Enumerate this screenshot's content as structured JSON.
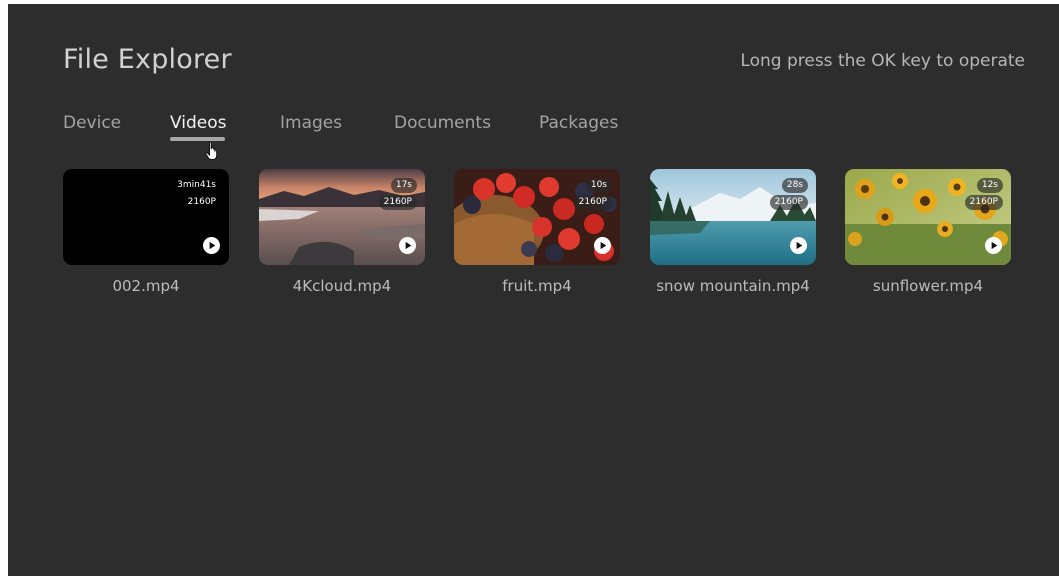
{
  "app": {
    "title": "File Explorer",
    "hint": "Long press the OK key to operate"
  },
  "tabs": [
    {
      "label": "Device",
      "active": false
    },
    {
      "label": "Videos",
      "active": true
    },
    {
      "label": "Images",
      "active": false
    },
    {
      "label": "Documents",
      "active": false
    },
    {
      "label": "Packages",
      "active": false
    }
  ],
  "videos": [
    {
      "name": "002.mp4",
      "duration": "3min41s",
      "resolution": "2160P",
      "thumbnail": "black"
    },
    {
      "name": "4Kcloud.mp4",
      "duration": "17s",
      "resolution": "2160P",
      "thumbnail": "sunset-lake"
    },
    {
      "name": "fruit.mp4",
      "duration": "10s",
      "resolution": "2160P",
      "thumbnail": "strawberries"
    },
    {
      "name": "snow mountain.mp4",
      "duration": "28s",
      "resolution": "2160P",
      "thumbnail": "mountain-lake"
    },
    {
      "name": "sunflower.mp4",
      "duration": "12s",
      "resolution": "2160P",
      "thumbnail": "sunflowers"
    }
  ],
  "colors": {
    "background": "#2d2d2d",
    "active_tab": "#f2f2f2",
    "inactive_tab": "#a3a3a3",
    "underline": "#a7a7a7"
  },
  "icons": {
    "play": "play-icon",
    "pointer": "hand-pointer-icon"
  }
}
